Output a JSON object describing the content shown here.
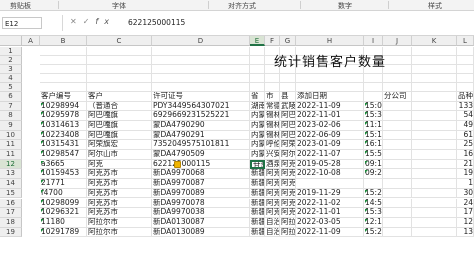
{
  "ribbon": {
    "groups": [
      "剪贴板",
      "字体",
      "对齐方式",
      "数字",
      "样式"
    ]
  },
  "formula_bar": {
    "name_box": "E12",
    "cancel_glyph": "✕",
    "enter_glyph": "✓",
    "fx_glyph": "fx",
    "value": "622125000115"
  },
  "columns": [
    "A",
    "B",
    "C",
    "D",
    "E",
    "F",
    "G",
    "H",
    "I",
    "J",
    "K",
    "L"
  ],
  "sheet": {
    "title": "统计销售客户数量",
    "header_row": {
      "row": "6",
      "cells": [
        "客户编号",
        "客户",
        "许可证号",
        "省",
        "市",
        "县",
        "添加日期",
        "",
        "分公司",
        "",
        "品种数",
        "数"
      ]
    },
    "rows": [
      {
        "n": "1",
        "cells": [
          "",
          "",
          "",
          "",
          "",
          "",
          "",
          "",
          "",
          "",
          "",
          ""
        ]
      },
      {
        "n": "2",
        "cells": [
          "",
          "",
          "",
          "",
          "",
          "",
          "",
          "",
          "",
          "",
          "",
          ""
        ]
      },
      {
        "n": "3",
        "cells": [
          "",
          "",
          "",
          "",
          "",
          "",
          "",
          "",
          "",
          "",
          "",
          ""
        ]
      },
      {
        "n": "4",
        "cells": [
          "",
          "",
          "",
          "",
          "",
          "",
          "",
          "",
          "",
          "",
          "",
          ""
        ]
      },
      {
        "n": "5",
        "cells": [
          "",
          "",
          "",
          "",
          "",
          "",
          "",
          "",
          "",
          "",
          "",
          ""
        ]
      },
      {
        "n": "7",
        "cells": [
          "10298994",
          "（普通合",
          "PDY3449564307021",
          "湖南",
          "常德",
          "武陵",
          "2022-11-09",
          "15:0",
          "",
          "",
          "133",
          ""
        ]
      },
      {
        "n": "8",
        "cells": [
          "10295978",
          "阿巴嘎旗",
          "6929669231525221",
          "内蒙",
          "锡林",
          "阿巴",
          "2022-11-01",
          "15:3",
          "",
          "",
          "54",
          ""
        ]
      },
      {
        "n": "9",
        "cells": [
          "10314613",
          "阿巴嘎旗",
          "蒙DA4790290",
          "内蒙",
          "锡林",
          "阿巴",
          "2023-02-06",
          "11:1",
          "",
          "",
          "49",
          ""
        ]
      },
      {
        "n": "10",
        "cells": [
          "10223408",
          "阿巴嘎旗",
          "蒙DA4790291",
          "内蒙",
          "锡林",
          "阿巴",
          "2022-06-09",
          "15:1",
          "",
          "",
          "61",
          ""
        ]
      },
      {
        "n": "11",
        "cells": [
          "10315431",
          "阿荣旗宏",
          "7352049575101811",
          "内蒙",
          "呼伦",
          "阿荣",
          "2023-01-09",
          "16:1",
          "",
          "",
          "25",
          ""
        ]
      },
      {
        "n": "11",
        "cells": [
          "10298547",
          "阿尔山市",
          "蒙DA4790509",
          "内蒙",
          "兴安",
          "阿尔",
          "2022-11-07",
          "15:5",
          "",
          "",
          "16",
          ""
        ]
      },
      {
        "n": "12",
        "cells": [
          "a3665",
          "阿克",
          "622125000115",
          "甘肃",
          "酒泉",
          "阿克",
          "2019-05-28",
          "09:1",
          "",
          "",
          "21",
          ""
        ]
      },
      {
        "n": "13",
        "cells": [
          "10159453",
          "阿克苏市",
          "新DA9970068",
          "新疆",
          "阿克",
          "阿克",
          "2022-10-08",
          "09:2",
          "",
          "",
          "19",
          ""
        ]
      },
      {
        "n": "14",
        "cells": [
          "21771",
          "阿克苏市",
          "新DA9970087",
          "新疆",
          "阿克",
          "阿克",
          "",
          "",
          "",
          "",
          "1",
          ""
        ]
      },
      {
        "n": "15",
        "cells": [
          "f4700",
          "阿克苏市",
          "新DA9970089",
          "新疆",
          "阿克",
          "阿克",
          "2019-11-29",
          "15:2",
          "",
          "",
          "30",
          ""
        ]
      },
      {
        "n": "16",
        "cells": [
          "10298099",
          "阿克苏市",
          "新DA9970078",
          "新疆",
          "阿克",
          "阿克",
          "2022-11-02",
          "14:5",
          "",
          "",
          "24",
          ""
        ]
      },
      {
        "n": "17",
        "cells": [
          "10296321",
          "阿克苏市",
          "新DA9970038",
          "新疆",
          "阿克",
          "阿克",
          "2022-11-01",
          "15:3",
          "",
          "",
          "17",
          ""
        ]
      },
      {
        "n": "18",
        "cells": [
          "11180",
          "阿拉尔市",
          "新DA0130087",
          "新疆",
          "自治",
          "阿拉",
          "2022-03-05",
          "12:1",
          "",
          "",
          "12",
          ""
        ]
      },
      {
        "n": "19",
        "cells": [
          "10291789",
          "阿拉尔市",
          "新DA0130089",
          "新疆",
          "自治",
          "阿拉",
          "2022-11-09",
          "15:2",
          "",
          "",
          "13",
          ""
        ]
      }
    ]
  }
}
